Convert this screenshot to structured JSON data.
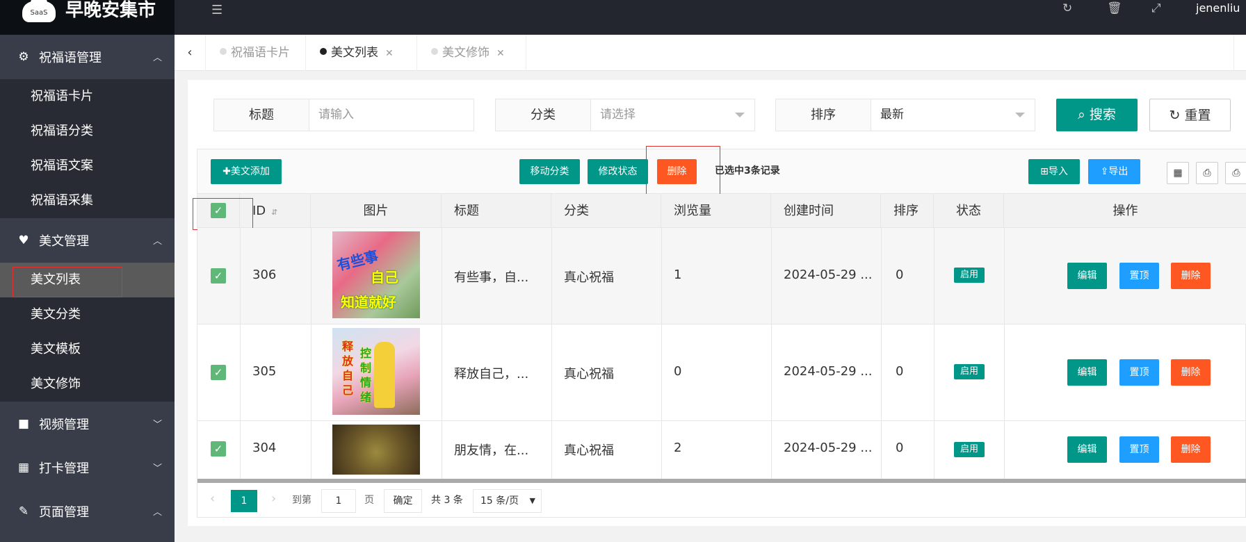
{
  "app": {
    "logo_text": "SaaS",
    "name": "早晚安集市",
    "user": "jenenliu"
  },
  "sidebar": {
    "groups": [
      {
        "label": "祝福语管理",
        "icon": "gear-icon",
        "arrow": "^"
      },
      {
        "label": "美文管理",
        "icon": "heart-icon",
        "arrow": "^"
      },
      {
        "label": "视频管理",
        "icon": "video-icon",
        "arrow": "v"
      },
      {
        "label": "打卡管理",
        "icon": "calendar-icon",
        "arrow": "v"
      },
      {
        "label": "页面管理",
        "icon": "wrench-icon",
        "arrow": "^"
      }
    ],
    "sub1": [
      "祝福语卡片",
      "祝福语分类",
      "祝福语文案",
      "祝福语采集"
    ],
    "sub2": [
      "美文列表",
      "美文分类",
      "美文模板",
      "美文修饰"
    ]
  },
  "tabs": [
    {
      "label": "祝福语卡片"
    },
    {
      "label": "美文列表"
    },
    {
      "label": "美文修饰"
    }
  ],
  "search": {
    "title_label": "标题",
    "title_placeholder": "请输入",
    "category_label": "分类",
    "category_placeholder": "请选择",
    "sort_label": "排序",
    "sort_value": "最新",
    "search_btn": "搜索",
    "reset_btn": "重置"
  },
  "toolbar": {
    "add": "美文添加",
    "move": "移动分类",
    "status": "修改状态",
    "delete": "删除",
    "selected": "已选中3条记录",
    "import": "导入",
    "export": "导出"
  },
  "columns": {
    "id": "ID",
    "image": "图片",
    "title": "标题",
    "category": "分类",
    "views": "浏览量",
    "created": "创建时间",
    "sort": "排序",
    "state": "状态",
    "ops": "操作"
  },
  "rows": [
    {
      "id": "306",
      "title": "有些事，自...",
      "category": "真心祝福",
      "views": "1",
      "created": "2024-05-29 ...",
      "sort": "0",
      "state": "启用",
      "pic_text": [
        "有些事",
        "自己",
        "知道就好"
      ]
    },
    {
      "id": "305",
      "title": "释放自己，...",
      "category": "真心祝福",
      "views": "0",
      "created": "2024-05-29 ...",
      "sort": "0",
      "state": "启用",
      "pic_text": [
        "释放自己",
        "控制情绪"
      ]
    },
    {
      "id": "304",
      "title": "朋友情，在...",
      "category": "真心祝福",
      "views": "2",
      "created": "2024-05-29 ...",
      "sort": "0",
      "state": "启用",
      "pic_text": []
    }
  ],
  "row_actions": {
    "edit": "编辑",
    "top": "置顶",
    "delete": "删除"
  },
  "pager": {
    "current": "1",
    "goto": "到第",
    "page_input": "1",
    "page_unit": "页",
    "confirm": "确定",
    "total": "共 3 条",
    "per_page": "15 条/页"
  }
}
